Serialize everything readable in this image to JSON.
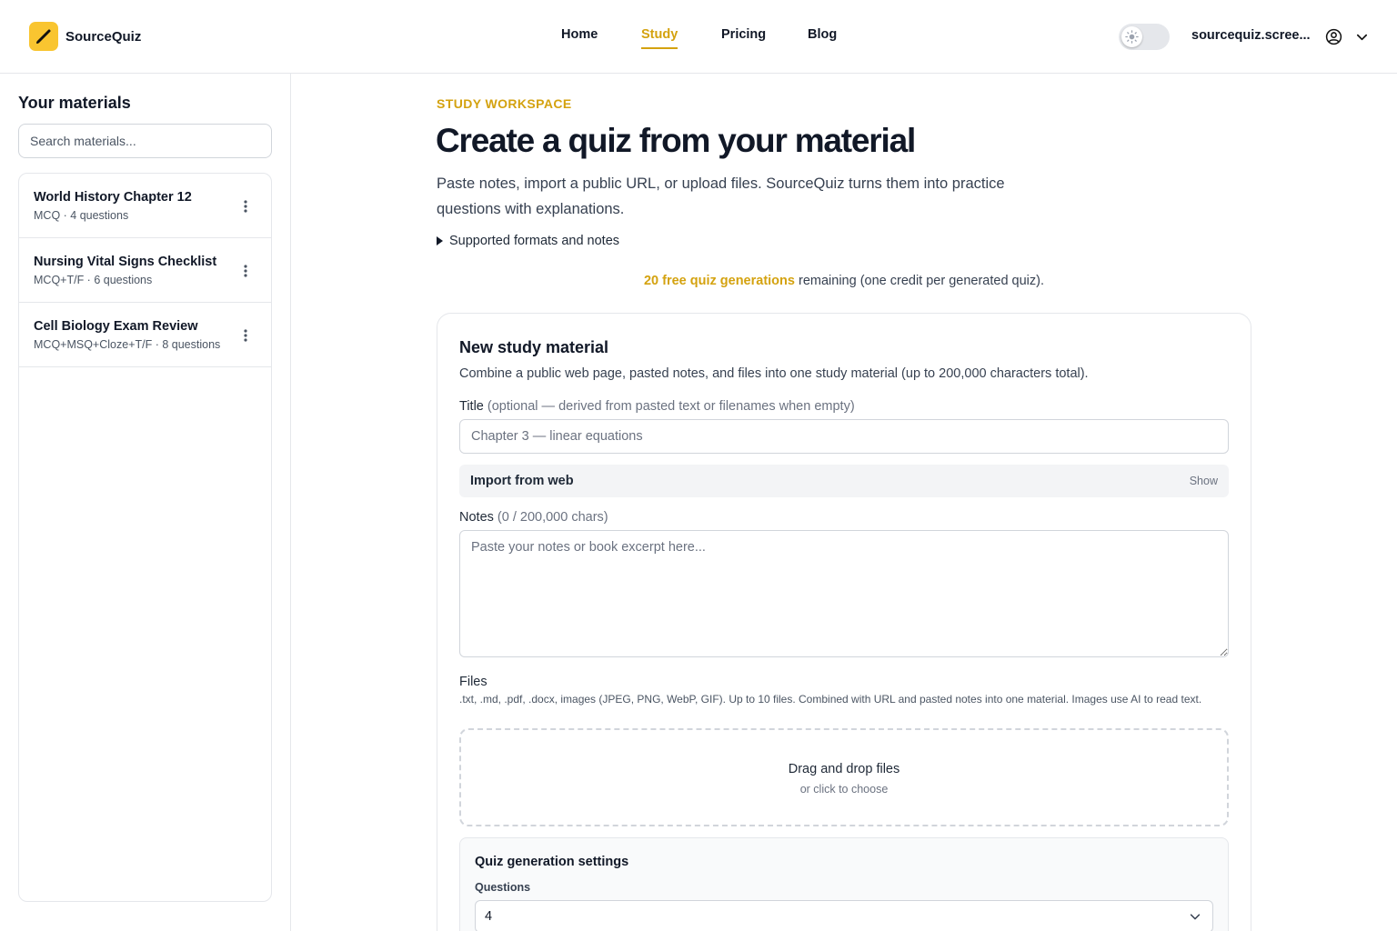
{
  "header": {
    "brand": "SourceQuiz",
    "nav": [
      {
        "label": "Home",
        "active": false
      },
      {
        "label": "Study",
        "active": true
      },
      {
        "label": "Pricing",
        "active": false
      },
      {
        "label": "Blog",
        "active": false
      }
    ],
    "account_name": "sourcequiz.scree...",
    "theme_toggle": {
      "icon": "sun-icon",
      "state": "light"
    },
    "account_icon": "user-circle-icon",
    "account_menu_icon": "chevron-down-icon"
  },
  "sidebar": {
    "title": "Your materials",
    "search_placeholder": "Search materials...",
    "materials": [
      {
        "title": "World History Chapter 12",
        "meta": "MCQ · 4 questions"
      },
      {
        "title": "Nursing Vital Signs Checklist",
        "meta": "MCQ+T/F · 6 questions"
      },
      {
        "title": "Cell Biology Exam Review",
        "meta": "MCQ+MSQ+Cloze+T/F · 8 questions"
      }
    ]
  },
  "main": {
    "eyebrow": "STUDY WORKSPACE",
    "headline": "Create a quiz from your material",
    "intro": "Paste notes, import a public URL, or upload files. SourceQuiz turns them into practice questions with explanations.",
    "details_summary": "Supported formats and notes",
    "credits_highlight": "20 free quiz generations",
    "credits_rest": " remaining (one credit per generated quiz).",
    "card": {
      "title": "New study material",
      "description": "Combine a public web page, pasted notes, and files into one study material (up to 200,000 characters total).",
      "title_label": "Title",
      "title_hint": " (optional — derived from pasted text or filenames when empty)",
      "title_placeholder": "Chapter 3 — linear equations",
      "import_label": "Import from web",
      "import_toggle": "Show",
      "notes_label": "Notes",
      "notes_hint": " (0 / 200,000 chars)",
      "notes_placeholder": "Paste your notes or book excerpt here...",
      "files_label": "Files",
      "files_help": ".txt, .md, .pdf, .docx, images (JPEG, PNG, WebP, GIF). Up to 10 files. Combined with URL and pasted notes into one material. Images use AI to read text.",
      "dropzone_title": "Drag and drop files",
      "dropzone_sub": "or click to choose",
      "settings_title": "Quiz generation settings",
      "questions_label": "Questions",
      "questions_value": "4"
    }
  },
  "colors": {
    "accent": "#d4a20f",
    "logo_bg": "#f9c530",
    "border": "#e5e7eb"
  }
}
